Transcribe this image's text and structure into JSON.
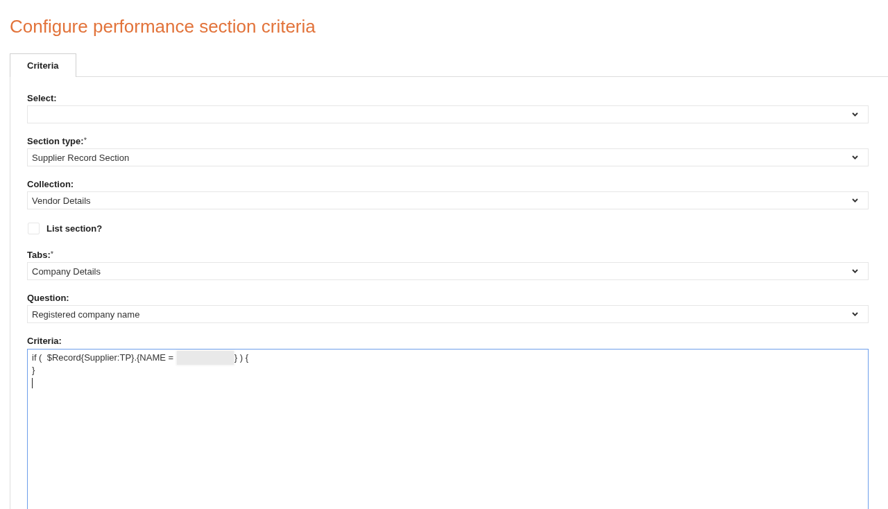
{
  "page": {
    "title": "Configure performance section criteria"
  },
  "tabs": [
    {
      "label": "Criteria",
      "selected": true
    }
  ],
  "fields": [
    {
      "kind": "select",
      "label": "Select:"
    },
    {
      "kind": "select",
      "label": "Section type:",
      "required_mark": "*",
      "value": "Supplier Record Section"
    },
    {
      "kind": "select",
      "label": "Collection:",
      "value": "Vendor Details"
    },
    {
      "kind": "checkbox",
      "label": "List section?",
      "checked": false
    },
    {
      "kind": "select",
      "label": "Tabs:",
      "required_mark": "*",
      "value": "Company Details"
    },
    {
      "kind": "select",
      "label": "Question:",
      "value": "Registered company name"
    },
    {
      "kind": "code",
      "label": "Criteria:",
      "focused": true,
      "lines": [
        {
          "segments": [
            {
              "kind": "text",
              "text": "if (  $Record{Supplier:TP}.{NAME = "
            },
            {
              "kind": "redacted"
            },
            {
              "kind": "text",
              "text": "} ) {"
            }
          ]
        },
        {
          "segments": [
            {
              "kind": "text",
              "text": "}"
            }
          ]
        }
      ]
    }
  ]
}
